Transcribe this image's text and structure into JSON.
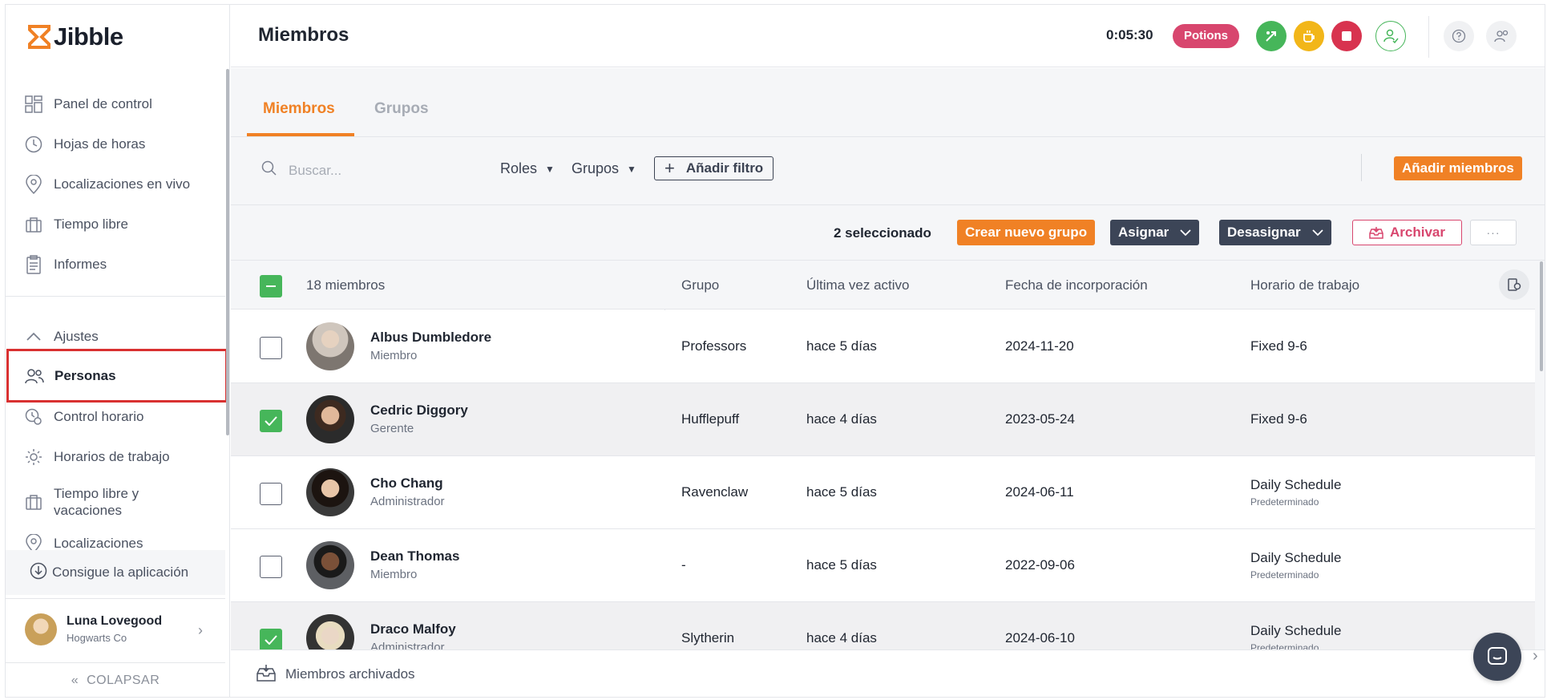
{
  "app": {
    "name": "Jibble"
  },
  "sidebar": {
    "items": [
      {
        "label": "Panel de control",
        "icon": "dashboard-icon"
      },
      {
        "label": "Hojas de horas",
        "icon": "clock-icon"
      },
      {
        "label": "Localizaciones en vivo",
        "icon": "location-pin-icon"
      },
      {
        "label": "Tiempo libre",
        "icon": "suitcase-icon"
      },
      {
        "label": "Informes",
        "icon": "report-icon"
      }
    ],
    "settings_label": "Ajustes",
    "settings_items": [
      {
        "label": "Personas",
        "icon": "people-icon"
      },
      {
        "label": "Control horario",
        "icon": "time-tracking-icon"
      },
      {
        "label": "Horarios de trabajo",
        "icon": "work-schedule-icon"
      },
      {
        "label": "Tiempo libre y vacaciones",
        "icon": "suitcase-icon"
      },
      {
        "label": "Localizaciones",
        "icon": "location-pin-icon"
      }
    ],
    "get_app": "Consigue la aplicación",
    "user": {
      "name": "Luna Lovegood",
      "org": "Hogwarts Co"
    },
    "collapse": "COLAPSAR"
  },
  "header": {
    "title": "Miembros",
    "timer": "0:05:30",
    "project": "Potions",
    "colors": {
      "green": "#46b65a",
      "yellow": "#f2b619",
      "red": "#d8334f",
      "accent": "#f08125"
    }
  },
  "tabs": [
    {
      "label": "Miembros"
    },
    {
      "label": "Grupos"
    }
  ],
  "filters": {
    "search_placeholder": "Buscar...",
    "roles": "Roles",
    "groups": "Grupos",
    "add_filter": "Añadir filtro",
    "add_members": "Añadir miembros"
  },
  "actions": {
    "selected": "2 seleccionado",
    "create_group": "Crear nuevo grupo",
    "assign": "Asignar",
    "unassign": "Desasignar",
    "archive": "Archivar",
    "more": "···"
  },
  "table": {
    "count_label": "18 miembros",
    "columns": [
      "Grupo",
      "Última vez activo",
      "Fecha de incorporación",
      "Horario de trabajo"
    ],
    "rows": [
      {
        "name": "Albus Dumbledore",
        "role": "Miembro",
        "group": "Professors",
        "last_active": "hace 5 días",
        "joined": "2024-11-20",
        "schedule": "Fixed 9-6",
        "schedule_sub": "",
        "checked": false
      },
      {
        "name": "Cedric Diggory",
        "role": "Gerente",
        "group": "Hufflepuff",
        "last_active": "hace 4 días",
        "joined": "2023-05-24",
        "schedule": "Fixed 9-6",
        "schedule_sub": "",
        "checked": true
      },
      {
        "name": "Cho Chang",
        "role": "Administrador",
        "group": "Ravenclaw",
        "last_active": "hace 5 días",
        "joined": "2024-06-11",
        "schedule": "Daily Schedule",
        "schedule_sub": "Predeterminado",
        "checked": false
      },
      {
        "name": "Dean Thomas",
        "role": "Miembro",
        "group": "-",
        "last_active": "hace 5 días",
        "joined": "2022-09-06",
        "schedule": "Daily Schedule",
        "schedule_sub": "Predeterminado",
        "checked": false
      },
      {
        "name": "Draco Malfoy",
        "role": "Administrador",
        "group": "Slytherin",
        "last_active": "hace 4 días",
        "joined": "2024-06-10",
        "schedule": "Daily Schedule",
        "schedule_sub": "Predeterminado",
        "checked": true
      }
    ]
  },
  "footer": {
    "archived": "Miembros archivados"
  }
}
